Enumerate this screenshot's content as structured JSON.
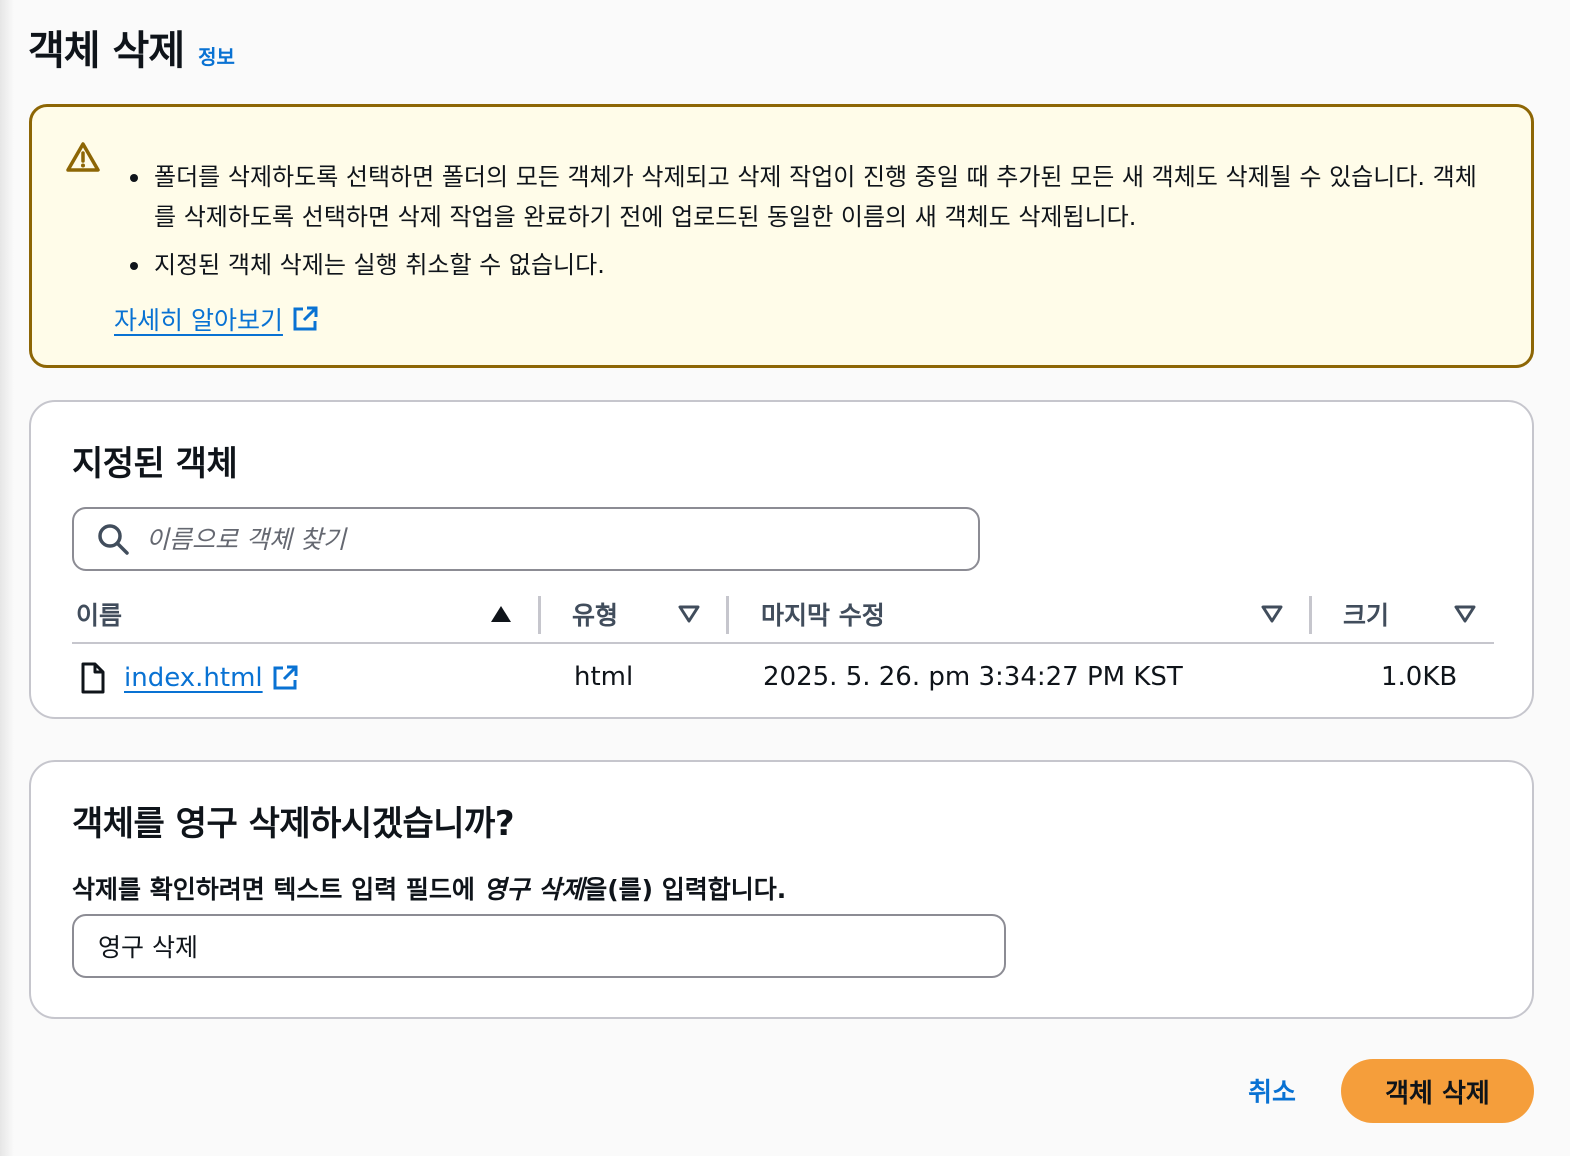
{
  "header": {
    "title": "객체 삭제",
    "info_link": "정보"
  },
  "alert": {
    "bullets": [
      "폴더를 삭제하도록 선택하면 폴더의 모든 객체가 삭제되고 삭제 작업이 진행 중일 때 추가된 모든 새 객체도 삭제될 수 있습니다. 객체를 삭제하도록 선택하면 삭제 작업을 완료하기 전에 업로드된 동일한 이름의 새 객체도 삭제됩니다.",
      "지정된 객체 삭제는 실행 취소할 수 없습니다."
    ],
    "learn_more": "자세히 알아보기",
    "icon": "warning-icon",
    "border_color": "#8d6605",
    "background_color": "#fffce9"
  },
  "objects": {
    "title": "지정된 객체",
    "search": {
      "placeholder": "이름으로 객체 찾기",
      "value": ""
    },
    "columns": [
      {
        "label": "이름",
        "sort": "ascending"
      },
      {
        "label": "유형",
        "sort": "none"
      },
      {
        "label": "마지막 수정",
        "sort": "none"
      },
      {
        "label": "크기",
        "sort": "none"
      }
    ],
    "rows": [
      {
        "name": "index.html",
        "type": "html",
        "last_modified": "2025. 5. 26. pm 3:34:27 PM KST",
        "size": "1.0KB"
      }
    ]
  },
  "confirm": {
    "title": "객체를 영구 삭제하시겠습니까?",
    "label_prefix": "삭제를 확인하려면 텍스트 입력 필드에 ",
    "label_keyword": "영구 삭제",
    "label_suffix": "을(를) 입력합니다.",
    "input_value": "영구 삭제"
  },
  "actions": {
    "cancel": "취소",
    "delete": "객체 삭제",
    "delete_color": "#f59e3b",
    "link_color": "#0972d3"
  }
}
